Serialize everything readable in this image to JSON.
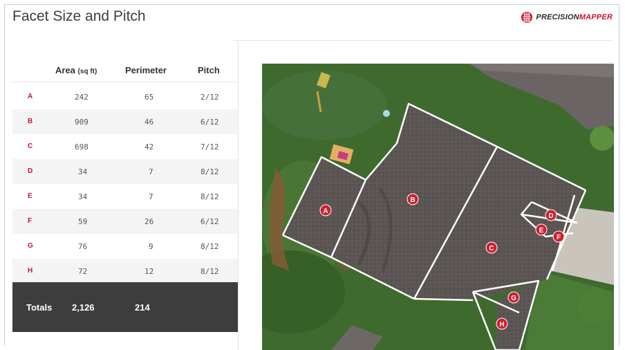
{
  "header": {
    "title": "Facet Size and Pitch"
  },
  "logo": {
    "part1": "PRECISION",
    "part2": "MAPPER"
  },
  "table": {
    "columns": {
      "area": "Area",
      "area_unit": "(sq ft)",
      "perimeter": "Perimeter",
      "pitch": "Pitch"
    },
    "rows": [
      {
        "label": "A",
        "area": "242",
        "perimeter": "65",
        "pitch": "2/12"
      },
      {
        "label": "B",
        "area": "909",
        "perimeter": "46",
        "pitch": "6/12"
      },
      {
        "label": "C",
        "area": "698",
        "perimeter": "42",
        "pitch": "7/12"
      },
      {
        "label": "D",
        "area": "34",
        "perimeter": "7",
        "pitch": "8/12"
      },
      {
        "label": "E",
        "area": "34",
        "perimeter": "7",
        "pitch": "8/12"
      },
      {
        "label": "F",
        "area": "59",
        "perimeter": "26",
        "pitch": "6/12"
      },
      {
        "label": "G",
        "area": "76",
        "perimeter": "9",
        "pitch": "8/12"
      },
      {
        "label": "H",
        "area": "72",
        "perimeter": "12",
        "pitch": "8/12"
      }
    ],
    "totals": {
      "label": "Totals",
      "area": "2,126",
      "perimeter": "214"
    }
  },
  "map": {
    "markers": [
      "A",
      "B",
      "C",
      "D",
      "E",
      "F",
      "G",
      "H"
    ],
    "colors": {
      "marker": "#d0202e",
      "outline": "#ffffff",
      "roof": "#5a5552",
      "grass": "#3f6a2e"
    }
  }
}
